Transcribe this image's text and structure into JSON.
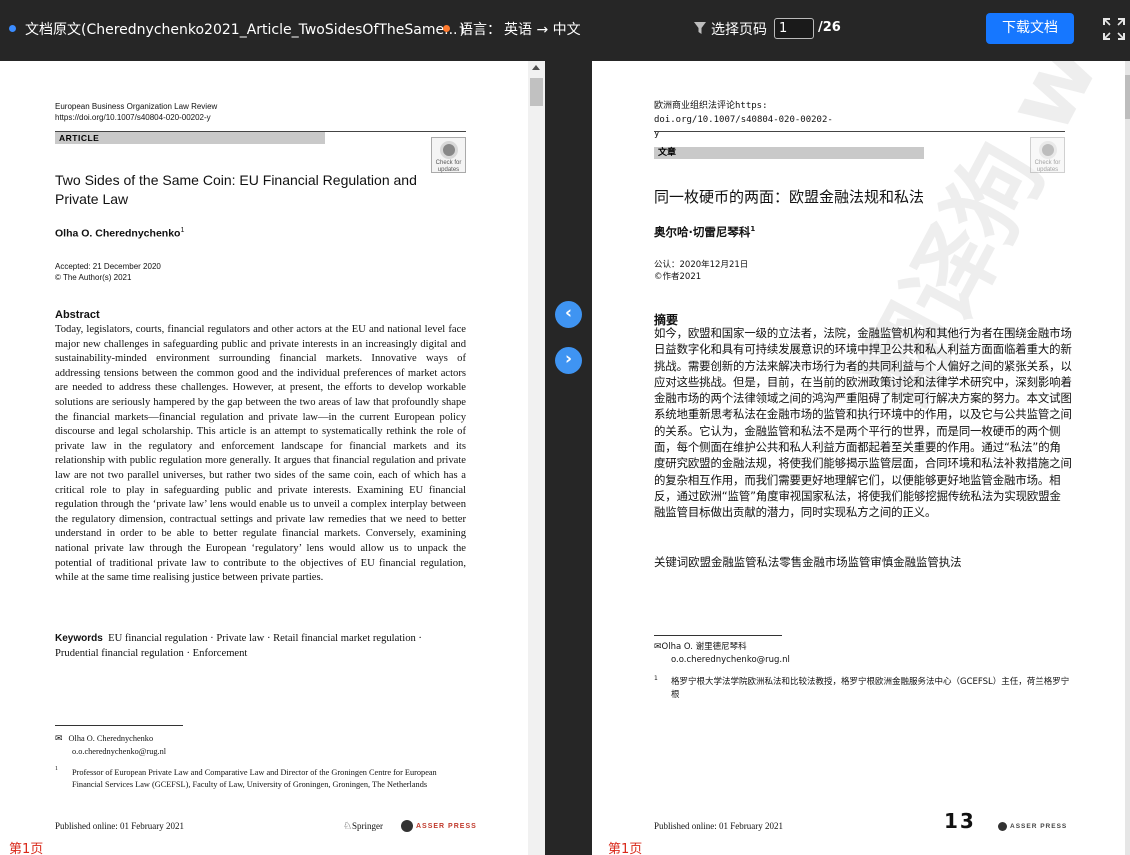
{
  "topbar": {
    "doc_title": "文档原文(Cherednychenko2021_Article_TwoSidesOfTheSame...",
    "doc_title_close": ")",
    "lang_label": "语言：",
    "lang_value": "英语 → 中文",
    "page_select_label": "选择页码",
    "page_current": "1",
    "page_total": "/26",
    "download_label": "下载文档",
    "icons": [
      "filter-icon",
      "fullscreen-icon"
    ],
    "colors": {
      "accent": "#1677ff",
      "status_blue": "#3b8cff",
      "status_orange": "#ff7a2e"
    }
  },
  "nav": {
    "prev": "‹",
    "next": "›"
  },
  "original": {
    "journal_name": "European Business Organization Law Review",
    "doi": "https://doi.org/10.1007/s40804-020-00202-y",
    "section": "ARTICLE",
    "badge": "Check for updates",
    "title": "Two Sides of the Same Coin: EU Financial Regulation and Private Law",
    "author": "Olha O. Cherednychenko",
    "author_sup": "1",
    "accepted": "Accepted: 21 December 2020",
    "copyright": "© The Author(s) 2021",
    "abstract_heading": "Abstract",
    "abstract": "Today, legislators, courts, financial regulators and other actors at the EU and national level face major new challenges in safeguarding public and private interests in an increasingly digital and sustainability-minded environment surrounding financial markets. Innovative ways of addressing tensions between the common good and the individual preferences of market actors are needed to address these challenges. However, at present, the efforts to develop workable solutions are seriously hampered by the gap between the two areas of law that profoundly shape the financial markets—financial regulation and private law—in the current European policy discourse and legal scholarship. This article is an attempt to systematically rethink the role of private law in the regulatory and enforcement landscape for financial markets and its relationship with public regulation more generally. It argues that financial regulation and private law are not two parallel universes, but rather two sides of the same coin, each of which has a critical role to play in safeguarding public and private interests. Examining EU financial regulation through the ‘private law’ lens would enable us to unveil a complex interplay between the regulatory dimension, contractual settings and private law remedies that we need to better understand in order to be able to better regulate financial markets. Conversely, examining national private law through the European ‘regulatory’ lens would allow us to unpack the potential of traditional private law to contribute to the objectives of EU financial regulation, while at the same time realising justice between private parties.",
    "keywords_label": "Keywords",
    "keywords": "EU financial regulation · Private law · Retail financial market regulation · Prudential financial regulation · Enforcement",
    "contact_name": "Olha O. Cherednychenko",
    "contact_email": "o.o.cherednychenko@rug.nl",
    "footnote_num": "1",
    "footnote": "Professor of European Private Law and Comparative Law and Director of the Groningen Centre for European Financial Services Law (GCEFSL), Faculty of Law, University of Groningen, Groningen, The Netherlands",
    "published": "Published online: 01 February 2021",
    "springer": "Springer",
    "asser": "ASSER PRESS",
    "page_label": "第1页"
  },
  "translation": {
    "journal_name": "欧洲商业组织法评论https: doi.org/10.1007/s40804-020-00202-y",
    "section": "文章",
    "badge": "Check for updates",
    "title": "同一枚硬币的两面：欧盟金融法规和私法",
    "author": "奥尔哈·切雷尼琴科",
    "author_sup": "1",
    "accepted": "公认：2020年12月21日",
    "copyright": "©作者2021",
    "abstract_heading": "摘要",
    "abstract": "如今，欧盟和国家一级的立法者，法院，金融监管机构和其他行为者在围绕金融市场日益数字化和具有可持续发展意识的环境中捍卫公共和私人利益方面面临着重大的新挑战。需要创新的方法来解决市场行为者的共同利益与个人偏好之间的紧张关系，以应对这些挑战。但是，目前，在当前的欧洲政策讨论和法律学术研究中，深刻影响着金融市场的两个法律领域之间的鸿沟严重阻碍了制定可行解决方案的努力。本文试图系统地重新思考私法在金融市场的监管和执行环境中的作用，以及它与公共监管之间的关系。它认为，金融监管和私法不是两个平行的世界，而是同一枚硬币的两个侧面，每个侧面在维护公共和私人利益方面都起着至关重要的作用。通过“私法”的角度研究欧盟的金融法规，将使我们能够揭示监管层面，合同环境和私法补救措施之间的复杂相互作用，而我们需要更好地理解它们，以便能够更好地监管金融市场。相反，通过欧洲“监管”角度审视国家私法，将使我们能够挖掘传统私法为实现欧盟金融监管目标做出贡献的潜力，同时实现私方之间的正义。",
    "keywords": "关键词欧盟金融监管私法零售金融市场监管审慎金融监管执法",
    "contact_name": "Olha O. 谢里德尼琴科",
    "contact_email": "o.o.cherednychenko@rug.nl",
    "footnote_num": "1",
    "footnote": "格罗宁根大学法学院欧洲私法和比较法教授，格罗宁根欧洲金融服务法中心（GCEFSL）主任，荷兰格罗宁根",
    "published": "Published online: 01 February 2021",
    "logo_13": "13",
    "asser": "ASSER PRESS",
    "watermark": "翻译狗 www.fanyigou",
    "page_label": "第1页"
  }
}
